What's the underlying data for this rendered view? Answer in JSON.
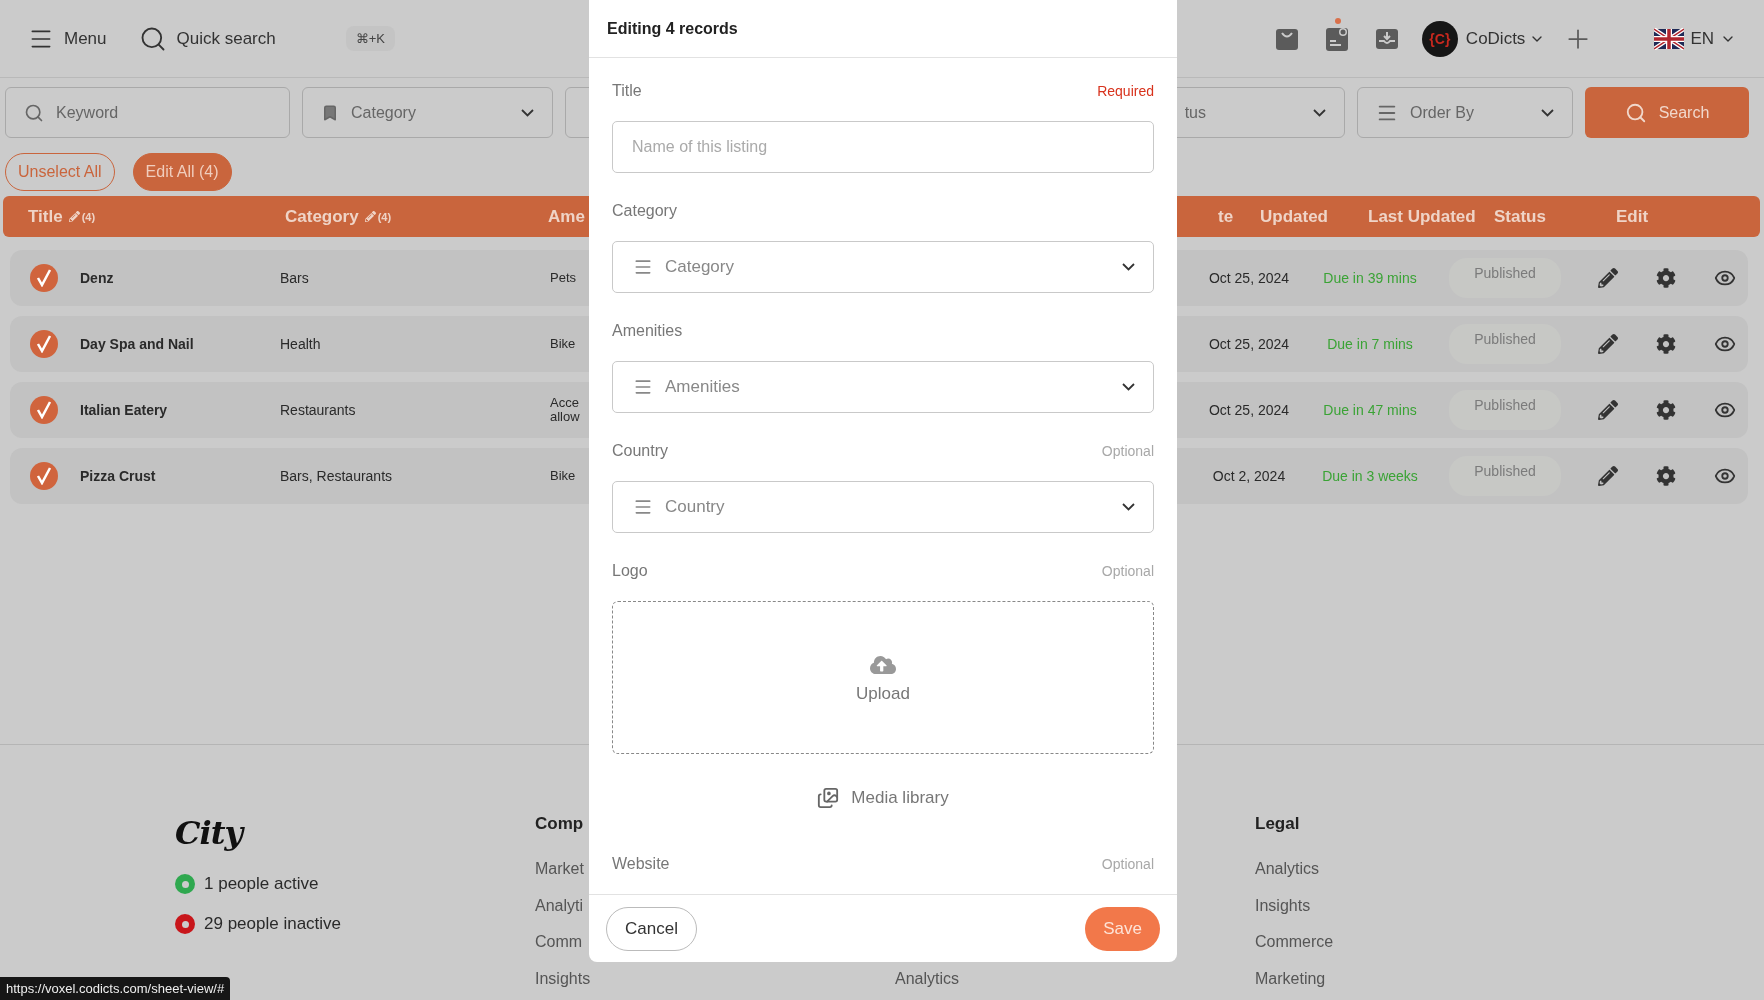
{
  "topbar": {
    "menu": "Menu",
    "quick_search": "Quick search",
    "shortcut": "⌘+K",
    "notification": true,
    "avatar_text": "{C}",
    "account": "CoDicts",
    "language": "EN"
  },
  "filters": {
    "keyword": "Keyword",
    "category": "Category",
    "status": "tus",
    "order_by": "Order By",
    "search": "Search"
  },
  "actions": {
    "unselect": "Unselect All",
    "edit_all": "Edit All (4)"
  },
  "table": {
    "columns_left": [
      {
        "label": "Title",
        "edit_count": "(4)"
      },
      {
        "label": "Category",
        "edit_count": "(4)"
      },
      {
        "label": "Ame"
      }
    ],
    "columns_right": [
      "te",
      "Updated",
      "Last Updated",
      "Status",
      "Edit"
    ],
    "rows": [
      {
        "checked": true,
        "title": "Denz",
        "category": "Bars",
        "amenities": "Pets",
        "updated": "Oct 25, 2024",
        "last_updated": "Due in 39 mins",
        "status": "Published"
      },
      {
        "checked": true,
        "title": "Day Spa and Nail",
        "category": "Health",
        "amenities": "Bike",
        "updated": "Oct 25, 2024",
        "last_updated": "Due in 7 mins",
        "status": "Published"
      },
      {
        "checked": true,
        "title": "Italian Eatery",
        "category": "Restaurants",
        "amenities": "Acce\nallow",
        "updated": "Oct 25, 2024",
        "last_updated": "Due in 47 mins",
        "status": "Published"
      },
      {
        "checked": true,
        "title": "Pizza Crust",
        "category": "Bars, Restaurants",
        "amenities": "Bike",
        "updated": "Oct 2, 2024",
        "last_updated": "Due in 3 weeks",
        "status": "Published"
      }
    ]
  },
  "footer": {
    "brand": "City",
    "presence": [
      {
        "label": "1 people active",
        "color": "#2fa84f"
      },
      {
        "label": "29 people inactive",
        "color": "#c8161b"
      }
    ],
    "columns": [
      {
        "heading": "Comp",
        "links": [
          "Market",
          "Analyti",
          "Comm",
          "Insights"
        ]
      },
      {
        "links": [
          "Analytics"
        ]
      },
      {
        "heading": "Legal",
        "links": [
          "Analytics",
          "Insights",
          "Commerce",
          "Marketing"
        ]
      }
    ]
  },
  "status_url": "https://voxel.codicts.com/sheet-view/#",
  "modal": {
    "title": "Editing 4 records",
    "fields": [
      {
        "kind": "text",
        "label": "Title",
        "note": "Required",
        "required": true,
        "placeholder": "Name of this listing"
      },
      {
        "kind": "select",
        "label": "Category",
        "placeholder": "Category"
      },
      {
        "kind": "select",
        "label": "Amenities",
        "placeholder": "Amenities"
      },
      {
        "kind": "select",
        "label": "Country",
        "note": "Optional",
        "required": false,
        "placeholder": "Country"
      },
      {
        "kind": "upload",
        "label": "Logo",
        "note": "Optional",
        "required": false,
        "upload": "Upload",
        "media_library": "Media library"
      },
      {
        "kind": "label",
        "label": "Website",
        "note": "Optional",
        "required": false
      }
    ],
    "cancel": "Cancel",
    "save": "Save"
  }
}
